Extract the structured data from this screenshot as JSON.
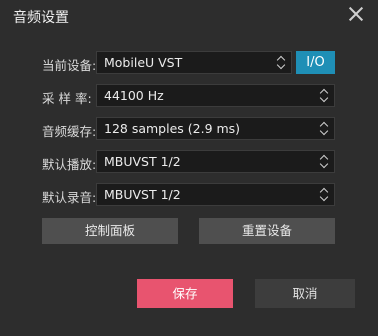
{
  "dialog": {
    "title": "音频设置"
  },
  "fields": {
    "device": {
      "label": "当前设备:",
      "value": "MobileU VST",
      "io_label": "I/O"
    },
    "sample_rate": {
      "label": "采 样 率:",
      "value": "44100 Hz"
    },
    "buffer": {
      "label": "音频缓存:",
      "value": "128 samples (2.9 ms)"
    },
    "playback": {
      "label": "默认播放:",
      "value": "MBUVST 1/2"
    },
    "recording": {
      "label": "默认录音:",
      "value": "MBUVST 1/2"
    }
  },
  "actions": {
    "control_panel": "控制面板",
    "reset_device": "重置设备",
    "save": "保存",
    "cancel": "取消"
  },
  "colors": {
    "accent": "#1f8fb6",
    "primary": "#e8546f",
    "background": "#2d2d2d"
  }
}
